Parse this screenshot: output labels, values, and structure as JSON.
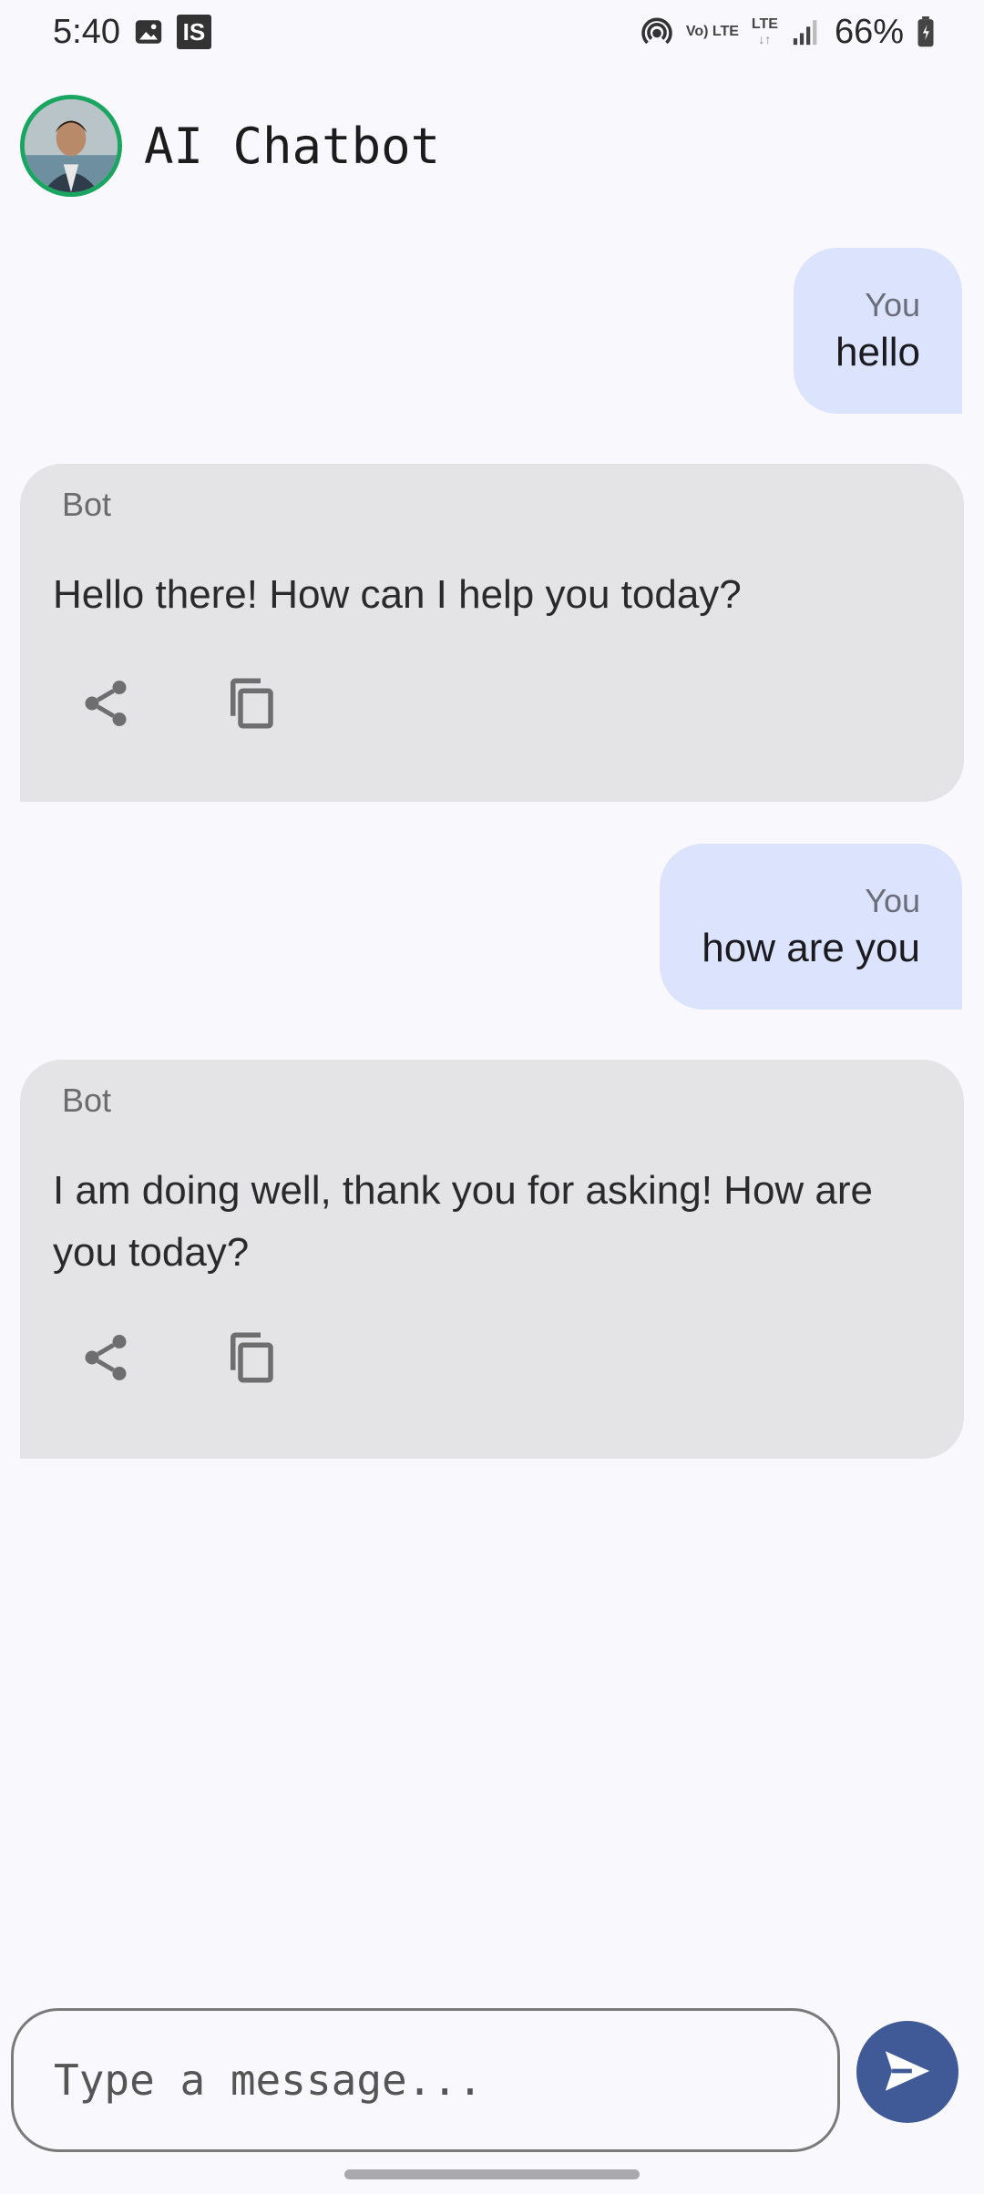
{
  "status_bar": {
    "time": "5:40",
    "is_badge": "IS",
    "lte_top": "Vo) LTE",
    "lte_bottom": "LTE",
    "battery": "66%"
  },
  "header": {
    "title": "AI Chatbot"
  },
  "messages": [
    {
      "role": "user",
      "sender": "You",
      "text": "hello"
    },
    {
      "role": "bot",
      "sender": "Bot",
      "text": "Hello there!  How can I help you today?"
    },
    {
      "role": "user",
      "sender": "You",
      "text": "how are you"
    },
    {
      "role": "bot",
      "sender": "Bot",
      "text": "I am doing well, thank you for asking!  How are you today?"
    }
  ],
  "composer": {
    "placeholder": "Type a message..."
  },
  "colors": {
    "user_bubble": "#dbe3fd",
    "bot_bubble": "#e4e4e7",
    "send_button": "#3f5a96",
    "avatar_ring": "#1aa561"
  },
  "icons": [
    "gallery-icon",
    "hotspot-icon",
    "signal-icon",
    "battery-icon",
    "share-icon",
    "copy-icon",
    "send-icon"
  ]
}
